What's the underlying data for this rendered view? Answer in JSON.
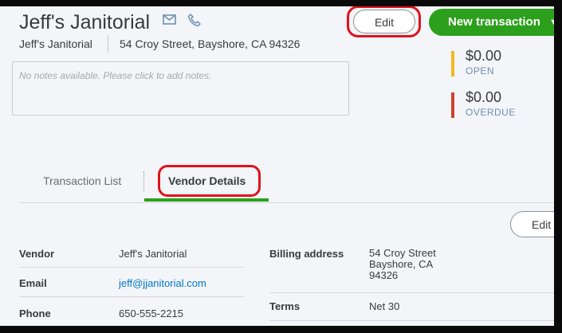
{
  "header": {
    "vendor_name": "Jeff's Janitorial",
    "sub_name": "Jeff's Janitorial",
    "address": "54 Croy Street, Bayshore, CA 94326",
    "notes_placeholder": "No notes available. Please click to add notes."
  },
  "actions": {
    "edit_label": "Edit",
    "new_transaction_label": "New transaction",
    "caret": "▼"
  },
  "stats": {
    "open_amount": "$0.00",
    "open_label": "OPEN",
    "overdue_amount": "$0.00",
    "overdue_label": "OVERDUE",
    "colors": {
      "open": "#f2b824",
      "overdue": "#c9452d"
    }
  },
  "tabs": [
    {
      "label": "Transaction List",
      "active": false
    },
    {
      "label": "Vendor Details",
      "active": true
    }
  ],
  "details": {
    "edit_label": "Edit",
    "vendor_label": "Vendor",
    "vendor_value": "Jeff's Janitorial",
    "email_label": "Email",
    "email_value": "jeff@jjanitorial.com",
    "phone_label": "Phone",
    "phone_value": "650-555-2215",
    "billing_label": "Billing address",
    "billing_lines": [
      "54 Croy Street",
      "Bayshore, CA",
      "94326"
    ],
    "terms_label": "Terms",
    "terms_value": "Net 30"
  },
  "icons": {
    "mail": "mail-icon",
    "phone": "phone-icon"
  },
  "accent_colors": {
    "primary_green": "#2ca01c",
    "highlight_red": "#e0121b",
    "link": "#0077c5"
  }
}
